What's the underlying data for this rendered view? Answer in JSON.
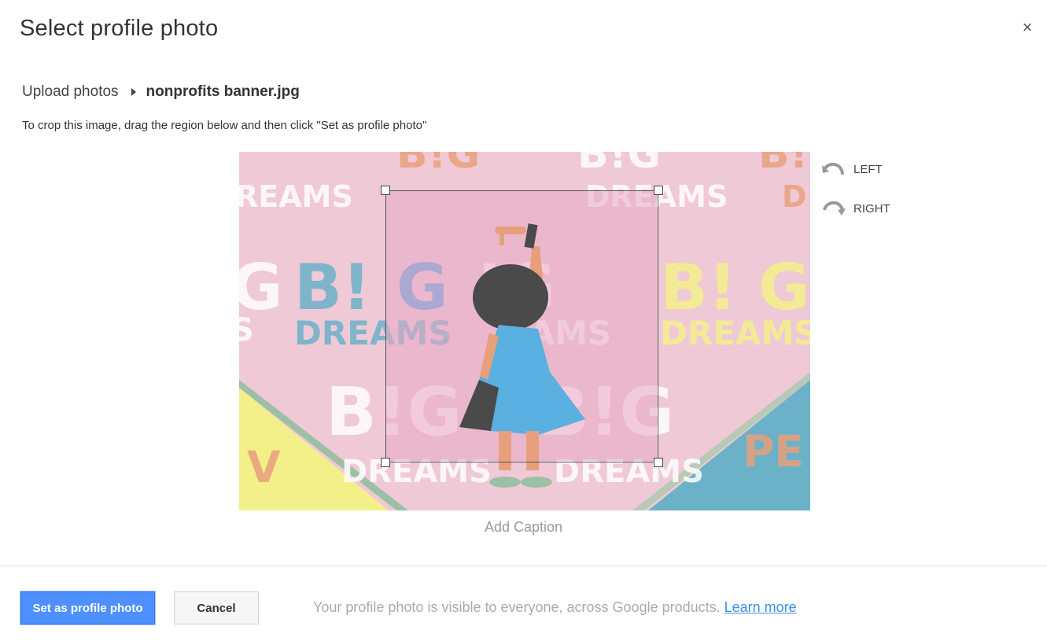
{
  "dialog": {
    "title": "Select profile photo",
    "close_glyph": "×"
  },
  "breadcrumb": {
    "parent": "Upload photos",
    "current": "nonprofits banner.jpg"
  },
  "instructions": "To crop this image, drag the region below and then click \"Set as profile photo\"",
  "image": {
    "subject": "girl-painting-big-dreams-wall",
    "wall_text": [
      "B!G",
      "DREAMS",
      "PE",
      "V"
    ],
    "colors": {
      "wall_pink": "#f0c9d6",
      "crop_pink": "#e8a8c4",
      "blue": "#4aa3e8",
      "yellow": "#f3f08a",
      "teal": "#6bb2c9",
      "orange": "#e8a07c",
      "dress": "#5ab0e0",
      "hair": "#4a4a4a"
    }
  },
  "rotate": {
    "left_label": "LEFT",
    "right_label": "RIGHT"
  },
  "caption_placeholder": "Add Caption",
  "actions": {
    "primary_label": "Set as profile photo",
    "cancel_label": "Cancel"
  },
  "footer": {
    "note": "Your profile photo is visible to everyone, across Google products.",
    "link": "Learn more"
  },
  "colors": {
    "primary_button": "#4d90fe",
    "link": "#3a8ee6",
    "muted_text": "#aaaaaa"
  }
}
